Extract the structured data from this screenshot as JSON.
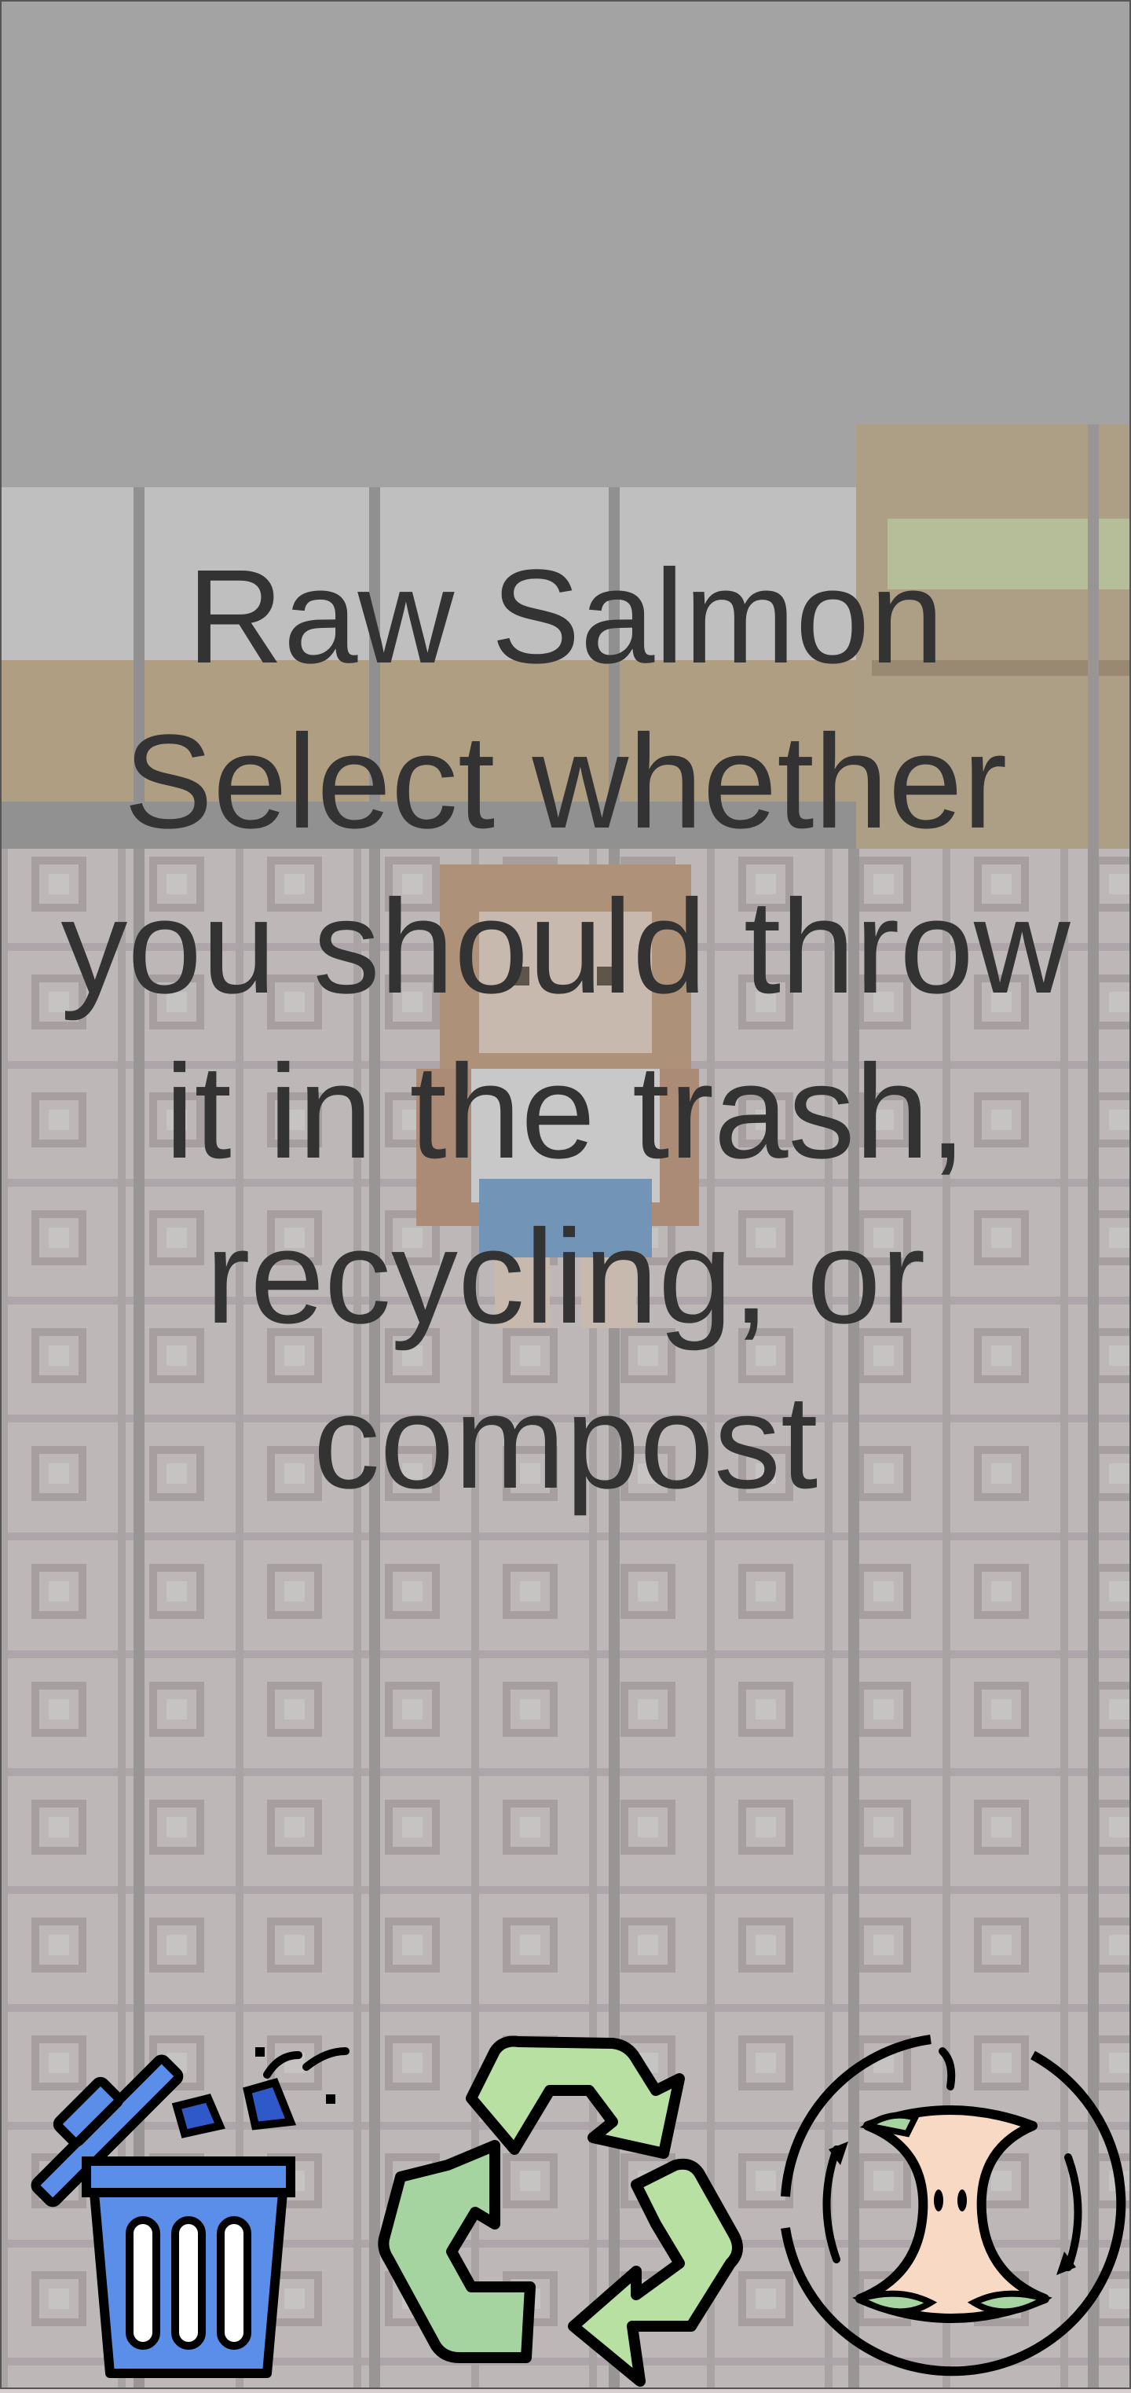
{
  "item": {
    "name": "Raw Salmon"
  },
  "prompt": {
    "line1": "Select whether",
    "line2": "you should throw",
    "line3": "it in the trash,",
    "line4": "recycling, or",
    "line5": "compost"
  },
  "choices": [
    {
      "id": "trash",
      "icon": "trash-can-icon",
      "color": "#5b8ee8"
    },
    {
      "id": "recycling",
      "icon": "recycle-icon",
      "color": "#a6d4a0"
    },
    {
      "id": "compost",
      "icon": "compost-apple-core-icon",
      "color": "#f7d9c4"
    }
  ],
  "colors": {
    "text": "#333333",
    "overlay": "#808080",
    "floor": "#d8d0d0",
    "wall": "#b3b3b3",
    "counter": "#c9b08a"
  }
}
